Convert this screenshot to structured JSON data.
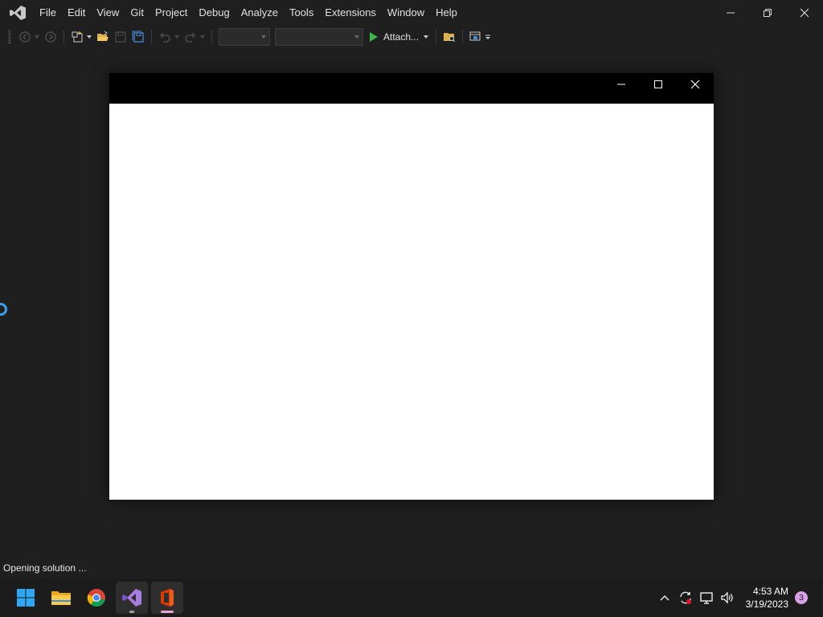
{
  "menubar": {
    "items": [
      "File",
      "Edit",
      "View",
      "Git",
      "Project",
      "Debug",
      "Analyze",
      "Tools",
      "Extensions",
      "Window",
      "Help"
    ],
    "logo_icon": "visual-studio-logo-icon",
    "window_controls": [
      "minimize-icon",
      "restore-icon",
      "close-icon"
    ]
  },
  "toolbar": {
    "attach_label": "Attach...",
    "config_combo_value": "",
    "platform_combo_value": "",
    "icons": [
      "navigate-back-icon",
      "navigate-forward-icon",
      "new-project-icon",
      "open-folder-icon",
      "save-icon",
      "save-all-icon",
      "undo-icon",
      "redo-icon",
      "start-debug-icon",
      "solution-explorer-icon",
      "layout-icon"
    ],
    "start_color": "#3bb44a"
  },
  "child_window": {
    "titlebar_color": "#000000",
    "content_color": "#ffffff"
  },
  "status": {
    "text": "Opening solution ..."
  },
  "taskbar": {
    "apps": [
      "windows-start-icon",
      "file-explorer-icon",
      "chrome-icon",
      "visual-studio-icon",
      "office-icon"
    ],
    "tray_icons": [
      "chevron-up-icon",
      "sync-icon",
      "display-icon",
      "volume-icon"
    ],
    "time": "4:53 AM",
    "date": "3/19/2023",
    "notification_count": "3"
  }
}
